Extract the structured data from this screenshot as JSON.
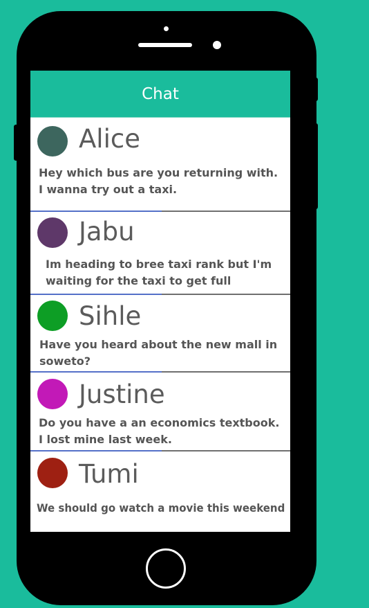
{
  "header": {
    "title": "Chat"
  },
  "colors": {
    "background": "#1abc9c",
    "header": "#1abc9c",
    "divider": "#6f6f6f",
    "divider_accent": "#5470c8"
  },
  "chats": [
    {
      "name": "Alice",
      "avatar_color": "#3d665e",
      "message_lines": [
        "Hey which bus are you returning with.",
        "I wanna try out a taxi."
      ]
    },
    {
      "name": "Jabu",
      "avatar_color": "#5e3869",
      "message_lines": [
        "Im heading to bree taxi rank but I'm",
        "waiting  for the taxi to get full"
      ]
    },
    {
      "name": "Sihle",
      "avatar_color": "#0d9e25",
      "message_lines": [
        "Have you heard about the new mall in",
        " soweto?"
      ]
    },
    {
      "name": "Justine",
      "avatar_color": "#c219b7",
      "message_lines": [
        "Do you have a an economics textbook.",
        "I lost mine last week."
      ]
    },
    {
      "name": "Tumi",
      "avatar_color": "#9e2012",
      "message_lines": [
        "We should go watch a movie this weekend"
      ]
    }
  ]
}
